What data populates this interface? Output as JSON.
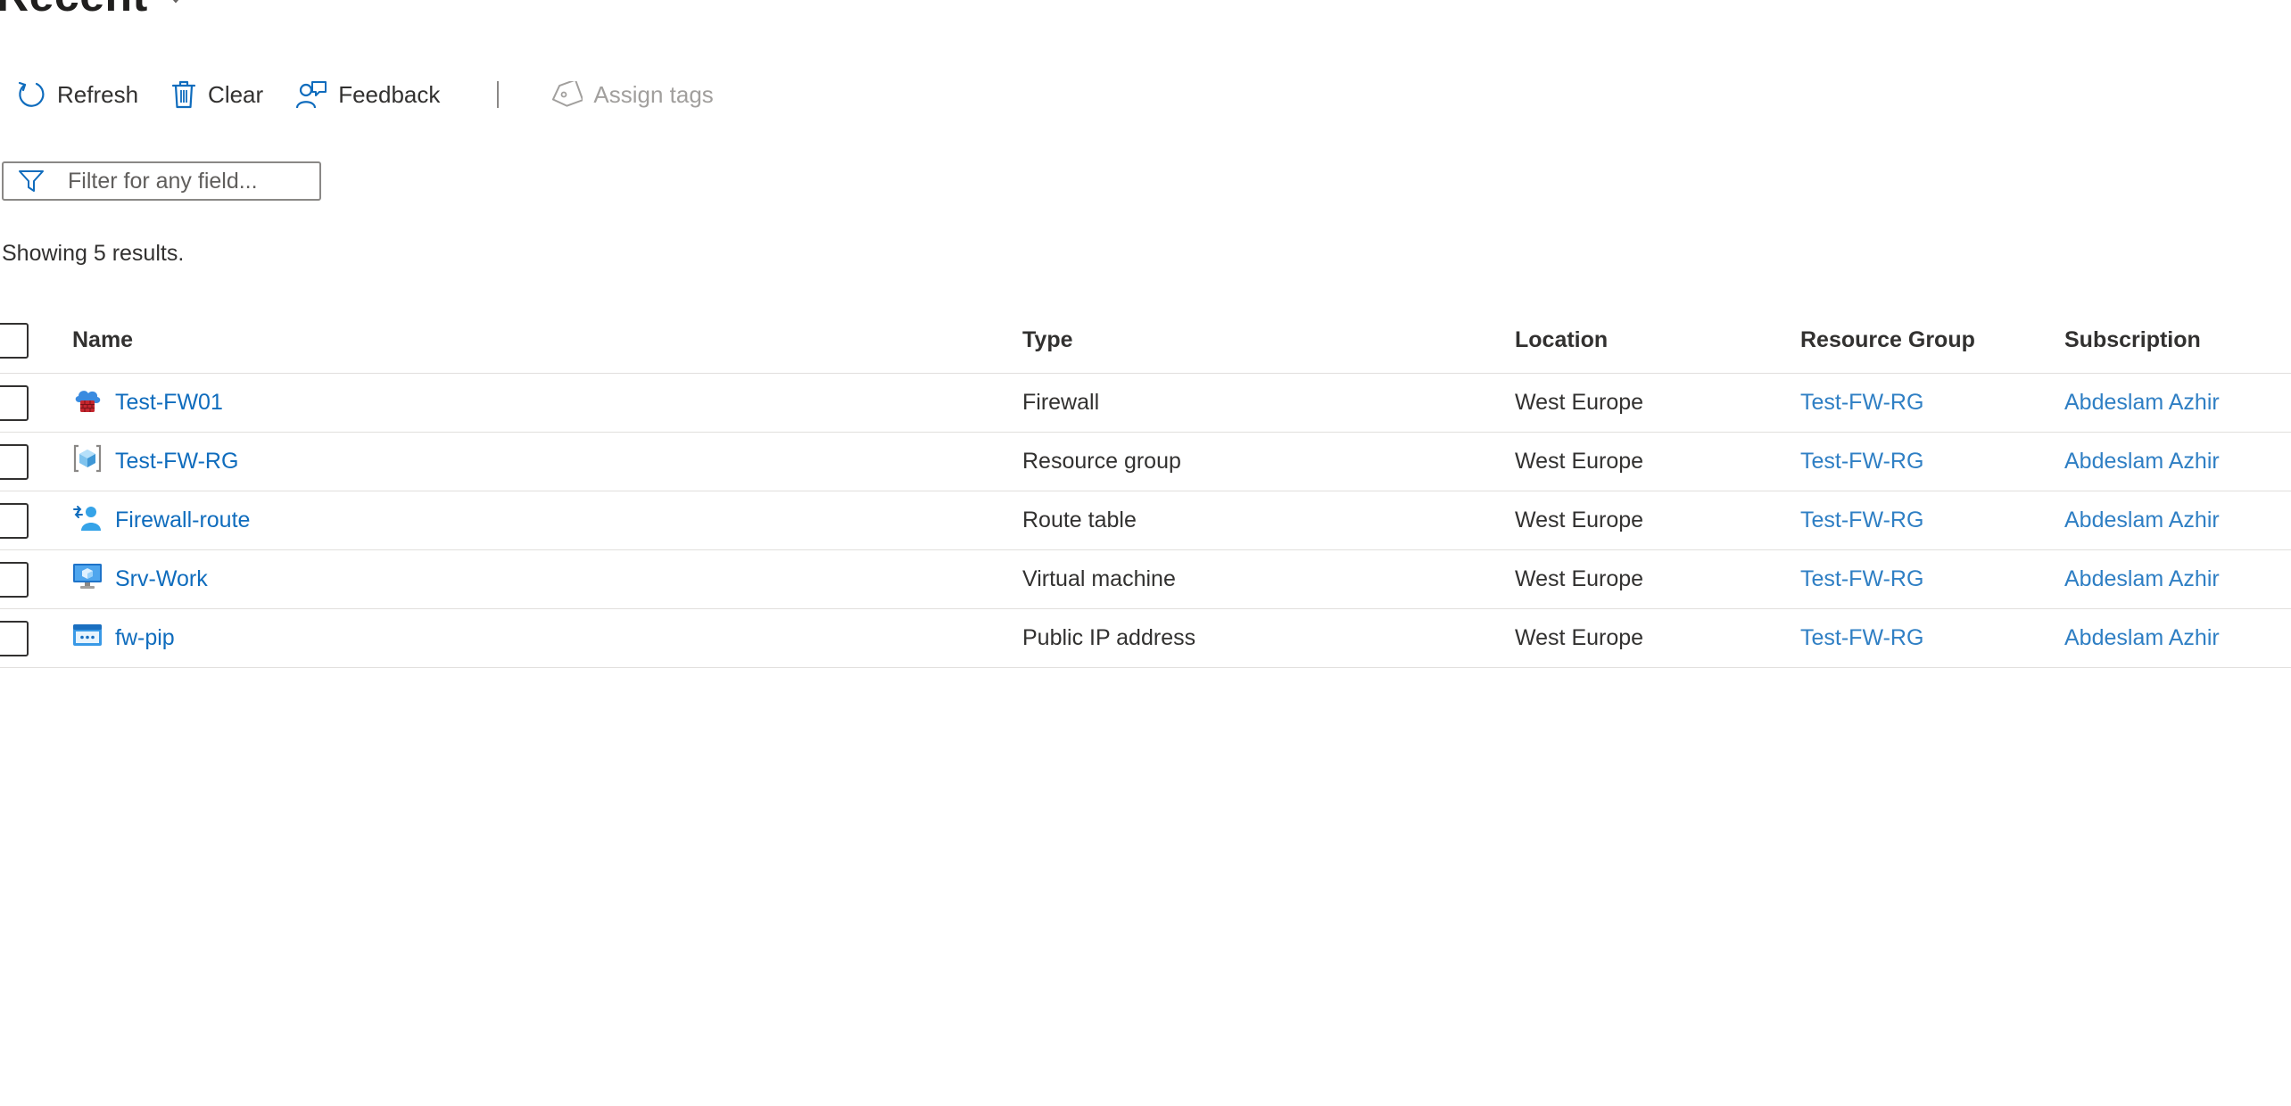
{
  "page": {
    "title": "Recent"
  },
  "toolbar": {
    "refresh_label": "Refresh",
    "clear_label": "Clear",
    "feedback_label": "Feedback",
    "assign_tags_label": "Assign tags"
  },
  "filter": {
    "placeholder": "Filter for any field...",
    "value": ""
  },
  "results": {
    "summary": "Showing 5 results."
  },
  "table": {
    "columns": {
      "name": "Name",
      "type": "Type",
      "location": "Location",
      "resource_group": "Resource Group",
      "subscription": "Subscription"
    },
    "rows": [
      {
        "icon": "firewall-icon",
        "name": "Test-FW01",
        "type": "Firewall",
        "location": "West Europe",
        "resource_group": "Test-FW-RG",
        "subscription": "Abdeslam Azhir"
      },
      {
        "icon": "resource-group-icon",
        "name": "Test-FW-RG",
        "type": "Resource group",
        "location": "West Europe",
        "resource_group": "Test-FW-RG",
        "subscription": "Abdeslam Azhir"
      },
      {
        "icon": "route-table-icon",
        "name": "Firewall-route",
        "type": "Route table",
        "location": "West Europe",
        "resource_group": "Test-FW-RG",
        "subscription": "Abdeslam Azhir"
      },
      {
        "icon": "virtual-machine-icon",
        "name": "Srv-Work",
        "type": "Virtual machine",
        "location": "West Europe",
        "resource_group": "Test-FW-RG",
        "subscription": "Abdeslam Azhir"
      },
      {
        "icon": "public-ip-icon",
        "name": "fw-pip",
        "type": "Public IP address",
        "location": "West Europe",
        "resource_group": "Test-FW-RG",
        "subscription": "Abdeslam Azhir"
      }
    ]
  },
  "colors": {
    "link": "#0f6cbd",
    "text": "#323130",
    "disabled": "#a19f9d",
    "divider": "#e1dfdd",
    "icon_accent": "#0078d4"
  }
}
